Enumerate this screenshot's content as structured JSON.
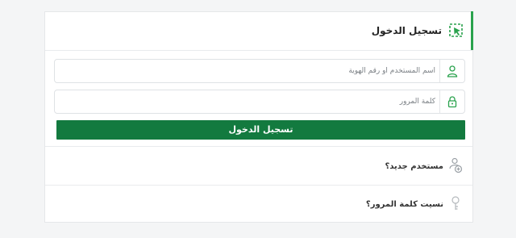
{
  "header": {
    "title": "تسجيل الدخول",
    "icon": "cursor-click-icon"
  },
  "form": {
    "username_placeholder": "اسم المستخدم أو رقم الهوية",
    "password_placeholder": "كلمة المرور",
    "submit_label": "تسجيل الدخول"
  },
  "links": {
    "new_user_label": "مستخدم جديد؟",
    "forgot_password_label": "نسيت كلمة المرور؟"
  },
  "colors": {
    "accent": "#2aa24d",
    "button": "#137a3f"
  }
}
